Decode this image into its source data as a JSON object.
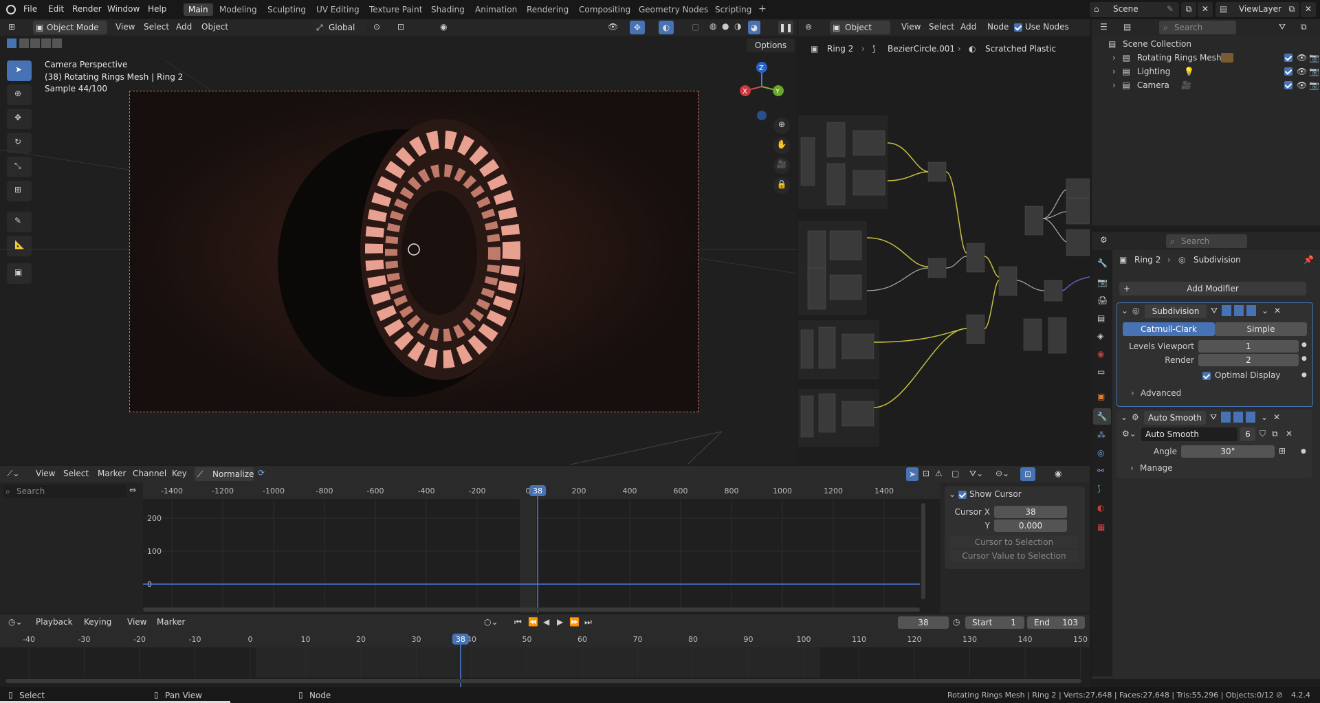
{
  "topbar": {
    "menus": [
      "File",
      "Edit",
      "Render",
      "Window",
      "Help"
    ],
    "workspaces": [
      "Main",
      "Modeling",
      "Sculpting",
      "UV Editing",
      "Texture Paint",
      "Shading",
      "Animation",
      "Rendering",
      "Compositing",
      "Geometry Nodes",
      "Scripting"
    ],
    "active_workspace": "Main",
    "add_tab": "+",
    "scene_label": "Scene",
    "viewlayer_label": "ViewLayer"
  },
  "viewport": {
    "mode": "Object Mode",
    "menus": [
      "View",
      "Select",
      "Add",
      "Object"
    ],
    "transform": "Global",
    "options_label": "Options",
    "overlay_title": "Camera Perspective",
    "overlay_object": "(38) Rotating Rings Mesh | Ring 2",
    "overlay_sample": "Sample 44/100",
    "gizmo": {
      "x": "X",
      "y": "Y",
      "z": "Z"
    }
  },
  "node_editor": {
    "type_label": "Object",
    "menus": [
      "View",
      "Select",
      "Add",
      "Node"
    ],
    "use_nodes_label": "Use Nodes",
    "breadcrumb": [
      "Ring 2",
      "BezierCircle.001",
      "Scratched Plastic"
    ]
  },
  "outliner": {
    "search_placeholder": "Search",
    "root": "Scene Collection",
    "items": [
      "Rotating Rings Mesh",
      "Lighting",
      "Camera"
    ]
  },
  "properties": {
    "search_placeholder": "Search",
    "breadcrumb_object": "Ring 2",
    "breadcrumb_tab": "Subdivision",
    "add_modifier": "Add Modifier",
    "subdivision": {
      "name": "Subdivision",
      "catmull_clark": "Catmull-Clark",
      "simple": "Simple",
      "levels_viewport_label": "Levels Viewport",
      "levels_viewport": "1",
      "render_label": "Render",
      "render": "2",
      "optimal_display": "Optimal Display",
      "advanced": "Advanced"
    },
    "auto_smooth": {
      "name": "Auto Smooth",
      "node_group": "Auto Smooth",
      "users": "6",
      "angle_label": "Angle",
      "angle": "30°",
      "manage": "Manage"
    }
  },
  "graph_editor": {
    "menus": [
      "View",
      "Select",
      "Marker",
      "Channel",
      "Key"
    ],
    "normalize": "Normalize",
    "search_placeholder": "Search",
    "x_ticks": [
      "-1400",
      "-1200",
      "-1000",
      "-800",
      "-600",
      "-400",
      "-200",
      "0",
      "200",
      "400",
      "600",
      "800",
      "1000",
      "1200",
      "1400"
    ],
    "y_ticks": [
      "200",
      "100",
      "0"
    ],
    "current_frame": "38",
    "show_cursor": "Show Cursor",
    "cursor_x_label": "Cursor X",
    "cursor_x": "38",
    "cursor_y_label": "Y",
    "cursor_y": "0.000",
    "cursor_to_selection": "Cursor to Selection",
    "cursor_value_to_selection": "Cursor Value to Selection"
  },
  "timeline": {
    "menus": [
      "Playback",
      "Keying",
      "View",
      "Marker"
    ],
    "current_frame": "38",
    "start_label": "Start",
    "start": "1",
    "end_label": "End",
    "end": "103",
    "ticks": [
      "-40",
      "-30",
      "-20",
      "-10",
      "0",
      "10",
      "20",
      "30",
      "40",
      "50",
      "60",
      "70",
      "80",
      "90",
      "100",
      "110",
      "120",
      "130",
      "140",
      "150"
    ]
  },
  "statusbar": {
    "select": "Select",
    "pan_view": "Pan View",
    "node": "Node",
    "stats": "Rotating Rings Mesh | Ring 2 | Verts:27,648 | Faces:27,648 | Tris:55,296 | Objects:0/12",
    "version": "4.2.4"
  },
  "colors": {
    "accent": "#4772b3",
    "background": "#1d1d1d",
    "header": "#2b2b2b",
    "wire_yellow": "#c8c040",
    "ring_pink": "#e8a090"
  }
}
